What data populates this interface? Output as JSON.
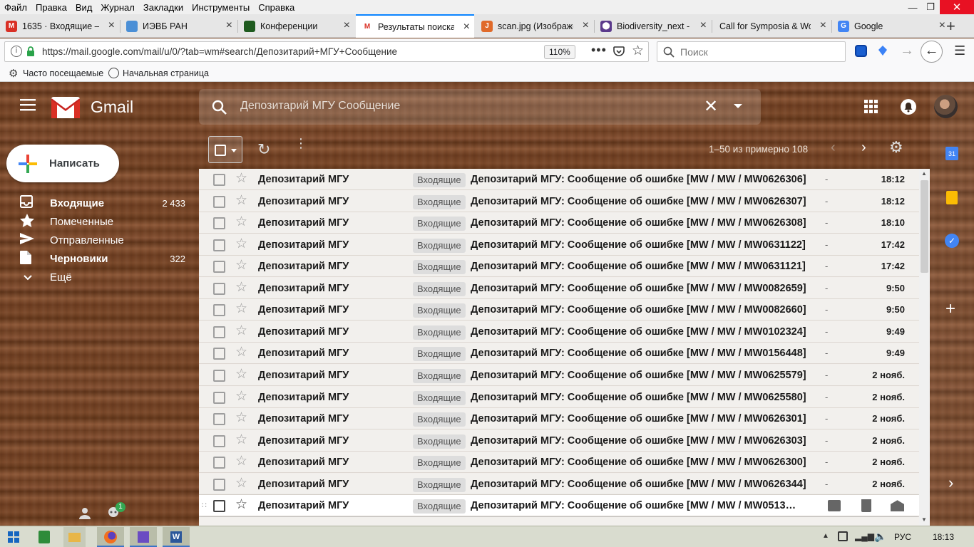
{
  "menubar": {
    "items": [
      "Файл",
      "Правка",
      "Вид",
      "Журнал",
      "Закладки",
      "Инструменты",
      "Справка"
    ]
  },
  "tabs": [
    {
      "title": "1635 · Входящие —",
      "color": "#d93025",
      "glyph": "M"
    },
    {
      "title": "ИЭВБ РАН",
      "color": "#4b8fd6",
      "glyph": ""
    },
    {
      "title": "Конференции",
      "color": "#1e5a1e",
      "glyph": ""
    },
    {
      "title": "Результаты поиска",
      "color": "#ffffff",
      "glyph": "M"
    },
    {
      "title": "scan.jpg (Изображе",
      "color": "#e06a2a",
      "glyph": "J"
    },
    {
      "title": "Biodiversity_next - b",
      "color": "#5b3a8c",
      "glyph": "⬤"
    },
    {
      "title": "Call for Symposia & Wo",
      "color": "",
      "glyph": ""
    },
    {
      "title": "Google",
      "color": "#4285f4",
      "glyph": "G"
    }
  ],
  "address": {
    "url": "https://mail.google.com/mail/u/0/?tab=wm#search/Депозитарий+МГУ+Сообщение",
    "zoom": "110%"
  },
  "browser_search": {
    "placeholder": "Поиск"
  },
  "bookmarks": {
    "frequent": "Часто посещаемые",
    "home": "Начальная страница"
  },
  "gmail": {
    "brand": "Gmail",
    "search_query": "Депозитарий МГУ Сообщение",
    "compose": "Написать",
    "nav": [
      {
        "label": "Входящие",
        "count": "2 433",
        "bold": true,
        "icon": "inbox-icon"
      },
      {
        "label": "Помеченные",
        "count": "",
        "bold": false,
        "icon": "star-icon"
      },
      {
        "label": "Отправленные",
        "count": "",
        "bold": false,
        "icon": "send-icon"
      },
      {
        "label": "Черновики",
        "count": "322",
        "bold": true,
        "icon": "draft-icon"
      },
      {
        "label": "Ещё",
        "count": "",
        "bold": false,
        "icon": "chevron-down-icon"
      }
    ],
    "pagination": "1–50 из примерно 108",
    "calendar_day": "31",
    "hangouts_badge": "1"
  },
  "emails": [
    {
      "sender": "Депозитарий МГУ",
      "label": "Входящие",
      "subject": "Депозитарий МГУ: Сообщение об ошибке [MW / MW / MW0626306]",
      "dash": "-",
      "time": "18:12"
    },
    {
      "sender": "Депозитарий МГУ",
      "label": "Входящие",
      "subject": "Депозитарий МГУ: Сообщение об ошибке [MW / MW / MW0626307]",
      "dash": "-",
      "time": "18:12"
    },
    {
      "sender": "Депозитарий МГУ",
      "label": "Входящие",
      "subject": "Депозитарий МГУ: Сообщение об ошибке [MW / MW / MW0626308]",
      "dash": "-",
      "time": "18:10"
    },
    {
      "sender": "Депозитарий МГУ",
      "label": "Входящие",
      "subject": "Депозитарий МГУ: Сообщение об ошибке [MW / MW / MW0631122]",
      "dash": "-",
      "time": "17:42"
    },
    {
      "sender": "Депозитарий МГУ",
      "label": "Входящие",
      "subject": "Депозитарий МГУ: Сообщение об ошибке [MW / MW / MW0631121]",
      "dash": "-",
      "time": "17:42"
    },
    {
      "sender": "Депозитарий МГУ",
      "label": "Входящие",
      "subject": "Депозитарий МГУ: Сообщение об ошибке [MW / MW / MW0082659]",
      "dash": "-",
      "time": "9:50"
    },
    {
      "sender": "Депозитарий МГУ",
      "label": "Входящие",
      "subject": "Депозитарий МГУ: Сообщение об ошибке [MW / MW / MW0082660]",
      "dash": "-",
      "time": "9:50"
    },
    {
      "sender": "Депозитарий МГУ",
      "label": "Входящие",
      "subject": "Депозитарий МГУ: Сообщение об ошибке [MW / MW / MW0102324]",
      "dash": "-",
      "time": "9:49"
    },
    {
      "sender": "Депозитарий МГУ",
      "label": "Входящие",
      "subject": "Депозитарий МГУ: Сообщение об ошибке [MW / MW / MW0156448]",
      "dash": "-",
      "time": "9:49"
    },
    {
      "sender": "Депозитарий МГУ",
      "label": "Входящие",
      "subject": "Депозитарий МГУ: Сообщение об ошибке [MW / MW / MW0625579]",
      "dash": "-",
      "time": "2 нояб."
    },
    {
      "sender": "Депозитарий МГУ",
      "label": "Входящие",
      "subject": "Депозитарий МГУ: Сообщение об ошибке [MW / MW / MW0625580]",
      "dash": "-",
      "time": "2 нояб."
    },
    {
      "sender": "Депозитарий МГУ",
      "label": "Входящие",
      "subject": "Депозитарий МГУ: Сообщение об ошибке [MW / MW / MW0626301]",
      "dash": "-",
      "time": "2 нояб."
    },
    {
      "sender": "Депозитарий МГУ",
      "label": "Входящие",
      "subject": "Депозитарий МГУ: Сообщение об ошибке [MW / MW / MW0626303]",
      "dash": "-",
      "time": "2 нояб."
    },
    {
      "sender": "Депозитарий МГУ",
      "label": "Входящие",
      "subject": "Депозитарий МГУ: Сообщение об ошибке [MW / MW / MW0626300]",
      "dash": "-",
      "time": "2 нояб."
    },
    {
      "sender": "Депозитарий МГУ",
      "label": "Входящие",
      "subject": "Депозитарий МГУ: Сообщение об ошибке [MW / MW / MW0626344]",
      "dash": "-",
      "time": "2 нояб."
    },
    {
      "sender": "Депозитарий МГУ",
      "label": "Входящие",
      "subject": "Депозитарий МГУ: Сообщение об ошибке [MW / MW / MW0513…",
      "dash": "",
      "time": "",
      "hover": true
    }
  ],
  "taskbar": {
    "lang": "РУС",
    "clock": "18:13"
  }
}
